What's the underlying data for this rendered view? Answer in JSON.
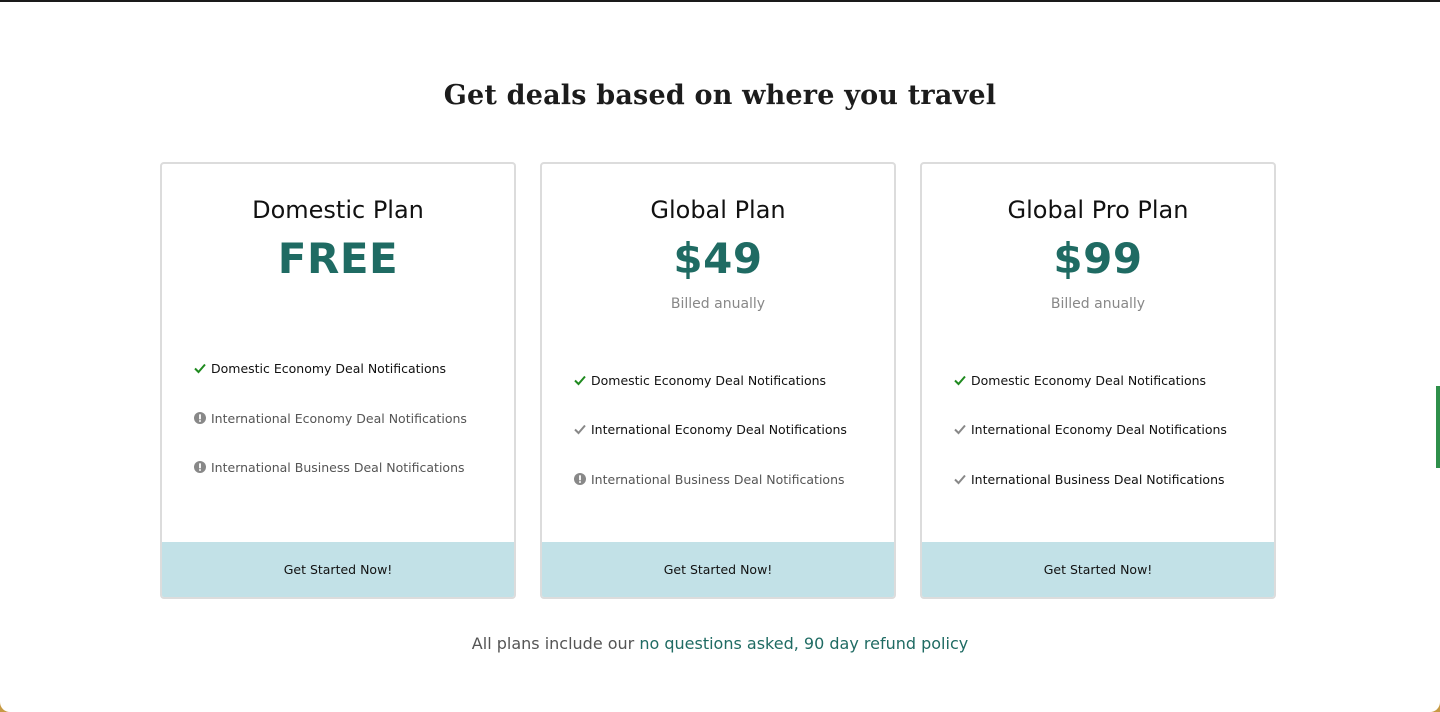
{
  "heading": "Get deals based on where you travel",
  "colors": {
    "accent": "#1f6b63",
    "check_green": "#1f8a1f",
    "check_gray": "#888888",
    "cta_bg": "#c2e1e7"
  },
  "plans": [
    {
      "title": "Domestic Plan",
      "price": "FREE",
      "billing": "",
      "features": [
        {
          "label": "Domestic Economy Deal Notifications",
          "icon": "check-icon",
          "status": "included"
        },
        {
          "label": "International Economy Deal Notifications",
          "icon": "info-icon",
          "status": "not-included"
        },
        {
          "label": "International Business Deal Notifications",
          "icon": "info-icon",
          "status": "not-included"
        }
      ],
      "cta": "Get Started Now!"
    },
    {
      "title": "Global Plan",
      "price": "$49",
      "billing": "Billed anually",
      "features": [
        {
          "label": "Domestic Economy Deal Notifications",
          "icon": "check-icon",
          "status": "included"
        },
        {
          "label": "International Economy Deal Notifications",
          "icon": "check-icon",
          "status": "included"
        },
        {
          "label": "International Business Deal Notifications",
          "icon": "info-icon",
          "status": "not-included"
        }
      ],
      "cta": "Get Started Now!"
    },
    {
      "title": "Global Pro Plan",
      "price": "$99",
      "billing": "Billed anually",
      "features": [
        {
          "label": "Domestic Economy Deal Notifications",
          "icon": "check-icon",
          "status": "included"
        },
        {
          "label": "International Economy Deal Notifications",
          "icon": "check-icon",
          "status": "included"
        },
        {
          "label": "International Business Deal Notifications",
          "icon": "check-icon",
          "status": "included"
        }
      ],
      "cta": "Get Started Now!"
    }
  ],
  "footer": {
    "prefix": "All plans include our ",
    "link": "no questions asked, 90 day refund policy"
  }
}
